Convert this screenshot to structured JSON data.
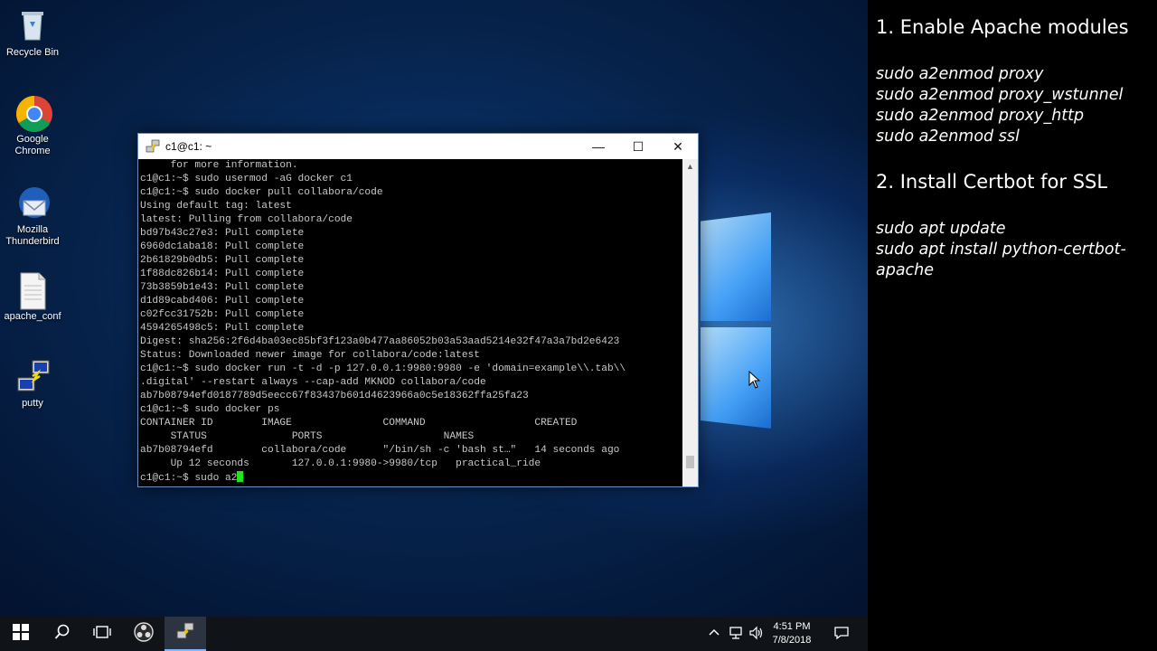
{
  "desktop": {
    "icons": [
      {
        "label": "Recycle Bin",
        "icon": "recycle-bin-icon"
      },
      {
        "label": "Google Chrome",
        "icon": "chrome-icon"
      },
      {
        "label": "Mozilla Thunderbird",
        "icon": "thunderbird-icon"
      },
      {
        "label": "apache_conf",
        "icon": "document-icon"
      },
      {
        "label": "putty",
        "icon": "putty-icon"
      }
    ]
  },
  "terminal": {
    "title": "c1@c1: ~",
    "controls": {
      "minimize": "—",
      "maximize": "☐",
      "close": "✕"
    },
    "lines": [
      "     for more information.",
      "c1@c1:~$ sudo usermod -aG docker c1",
      "c1@c1:~$ sudo docker pull collabora/code",
      "Using default tag: latest",
      "latest: Pulling from collabora/code",
      "bd97b43c27e3: Pull complete",
      "6960dc1aba18: Pull complete",
      "2b61829b0db5: Pull complete",
      "1f88dc826b14: Pull complete",
      "73b3859b1e43: Pull complete",
      "d1d89cabd406: Pull complete",
      "c02fcc31752b: Pull complete",
      "4594265498c5: Pull complete",
      "Digest: sha256:2f6d4ba03ec85bf3f123a0b477aa86052b03a53aad5214e32f47a3a7bd2e6423",
      "Status: Downloaded newer image for collabora/code:latest",
      "c1@c1:~$ sudo docker run -t -d -p 127.0.0.1:9980:9980 -e 'domain=example\\\\.tab\\\\",
      ".digital' --restart always --cap-add MKNOD collabora/code",
      "ab7b08794efd0187789d5eecc67f83437b601d4623966a0c5e18362ffa25fa23",
      "c1@c1:~$ sudo docker ps",
      "CONTAINER ID        IMAGE               COMMAND                  CREATED",
      "     STATUS              PORTS                    NAMES",
      "ab7b08794efd        collabora/code      \"/bin/sh -c 'bash st…\"   14 seconds ago",
      "     Up 12 seconds       127.0.0.1:9980->9980/tcp   practical_ride"
    ],
    "prompt_line": "c1@c1:~$ sudo a2"
  },
  "taskbar": {
    "clock_time": "4:51 PM",
    "clock_date": "7/8/2018"
  },
  "panel": {
    "step1_title": "1. Enable Apache modules",
    "step1_cmds": [
      "sudo a2enmod proxy",
      "sudo a2enmod proxy_wstunnel",
      "sudo a2enmod proxy_http",
      "sudo a2enmod ssl"
    ],
    "step2_title": "2. Install Certbot for SSL",
    "step2_cmds": [
      "sudo apt update",
      "sudo apt install python-certbot-",
      "apache"
    ]
  }
}
